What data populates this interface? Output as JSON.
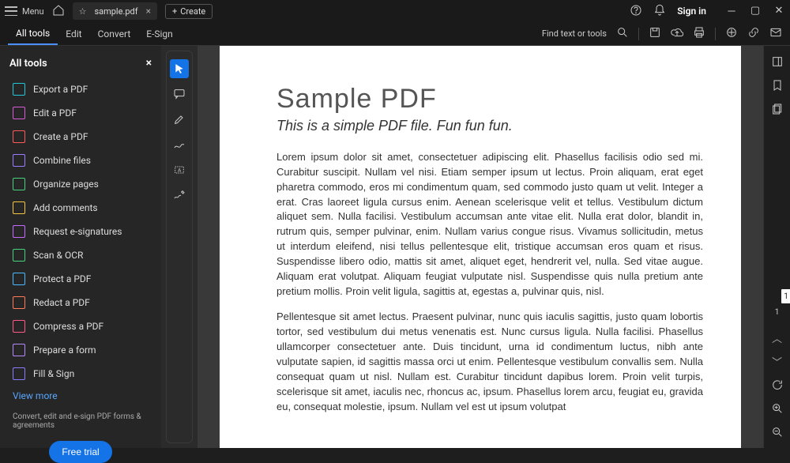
{
  "titlebar": {
    "menu": "Menu",
    "tab_title": "sample.pdf",
    "create": "Create",
    "signin": "Sign in"
  },
  "toolbar": {
    "tabs": [
      "All tools",
      "Edit",
      "Convert",
      "E-Sign"
    ],
    "find_placeholder": "Find text or tools"
  },
  "sidebar": {
    "title": "All tools",
    "items": [
      {
        "label": "Export a PDF",
        "color": "#26c6da"
      },
      {
        "label": "Edit a PDF",
        "color": "#d85bd8"
      },
      {
        "label": "Create a PDF",
        "color": "#ff5a5a"
      },
      {
        "label": "Combine files",
        "color": "#9b7bff"
      },
      {
        "label": "Organize pages",
        "color": "#48d17e"
      },
      {
        "label": "Add comments",
        "color": "#f5c542"
      },
      {
        "label": "Request e-signatures",
        "color": "#c66bff"
      },
      {
        "label": "Scan & OCR",
        "color": "#48d17e"
      },
      {
        "label": "Protect a PDF",
        "color": "#4ab9ff"
      },
      {
        "label": "Redact a PDF",
        "color": "#ff7b5a"
      },
      {
        "label": "Compress a PDF",
        "color": "#ff5a8a"
      },
      {
        "label": "Prepare a form",
        "color": "#b58aff"
      },
      {
        "label": "Fill & Sign",
        "color": "#8a7bff"
      }
    ],
    "view_more": "View more",
    "footer_text": "Convert, edit and e-sign PDF forms & agreements",
    "free_trial": "Free trial"
  },
  "document": {
    "heading": "Sample PDF",
    "subheading": "This is a simple PDF file. Fun fun fun.",
    "para1": "Lorem ipsum dolor sit amet, consectetuer adipiscing elit. Phasellus facilisis odio sed mi. Curabitur suscipit. Nullam vel nisi. Etiam semper ipsum ut lectus. Proin aliquam, erat eget pharetra commodo, eros mi condimentum quam, sed commodo justo quam ut velit. Integer a erat. Cras laoreet ligula cursus enim. Aenean scelerisque velit et tellus. Vestibulum dictum aliquet sem. Nulla facilisi. Vestibulum accumsan ante vitae elit. Nulla erat dolor, blandit in, rutrum quis, semper pulvinar, enim. Nullam varius congue risus. Vivamus sollicitudin, metus ut interdum eleifend, nisi tellus pellentesque elit, tristique accumsan eros quam et risus. Suspendisse libero odio, mattis sit amet, aliquet eget, hendrerit vel, nulla. Sed vitae augue. Aliquam erat volutpat. Aliquam feugiat vulputate nisl. Suspendisse quis nulla pretium ante pretium mollis. Proin velit ligula, sagittis at, egestas a, pulvinar quis, nisl.",
    "para2": "Pellentesque sit amet lectus. Praesent pulvinar, nunc quis iaculis sagittis, justo quam lobortis tortor, sed vestibulum dui metus venenatis est. Nunc cursus ligula. Nulla facilisi. Phasellus ullamcorper consectetuer ante. Duis tincidunt, urna id condimentum luctus, nibh ante vulputate sapien, id sagittis massa orci ut enim. Pellentesque vestibulum convallis sem. Nulla consequat quam ut nisl. Nullam est. Curabitur tincidunt dapibus lorem. Proin velit turpis, scelerisque sit amet, iaculis nec, rhoncus ac, ipsum. Phasellus lorem arcu, feugiat eu, gravida eu, consequat molestie, ipsum. Nullam vel est ut ipsum volutpat"
  },
  "page_indicator": {
    "current": "1",
    "total": "1"
  }
}
